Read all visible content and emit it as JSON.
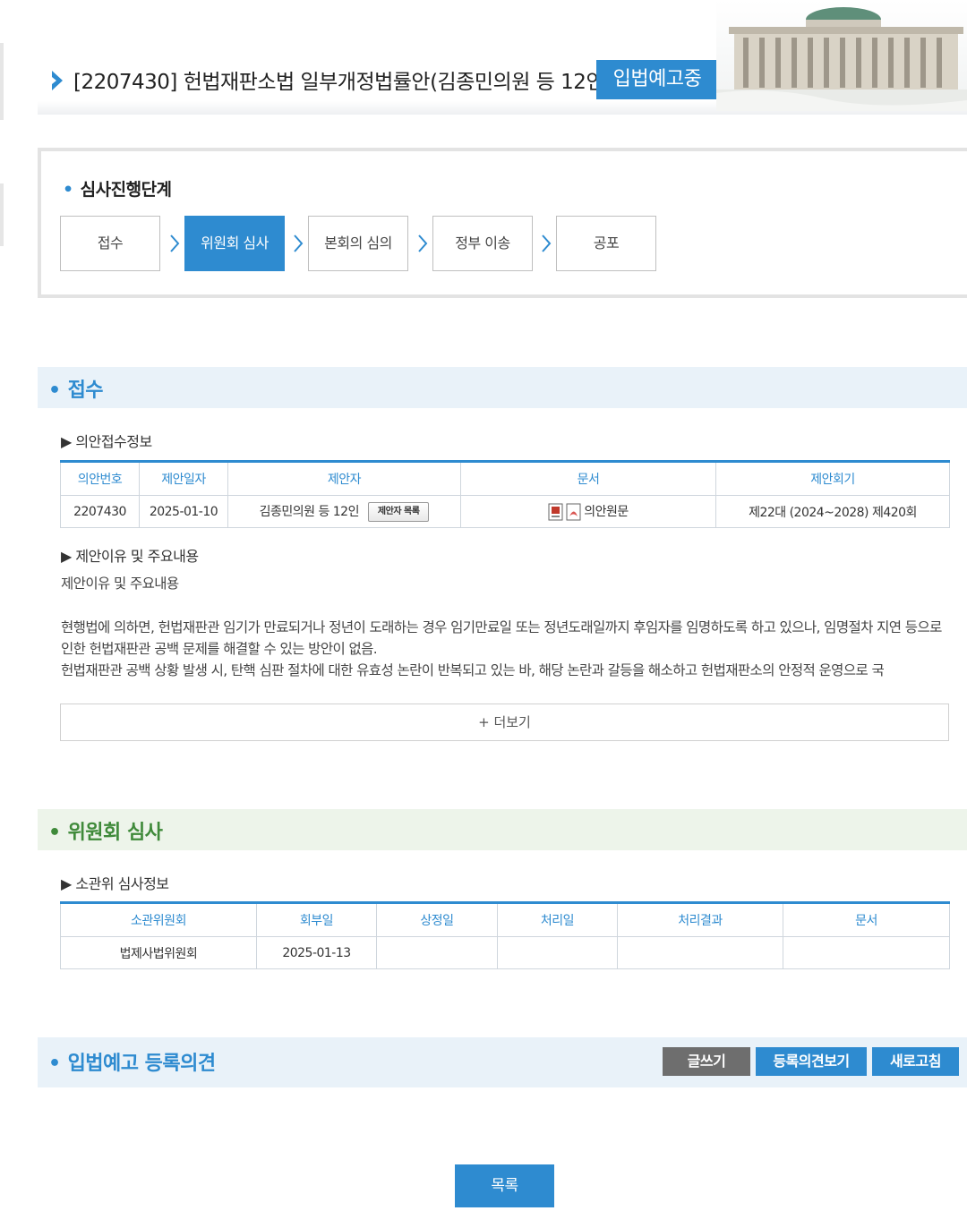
{
  "header": {
    "bill_title": "[2207430] 헌법재판소법 일부개정법률안(김종민의원 등 12인)",
    "status_badge": "입법예고중"
  },
  "progress": {
    "title": "심사진행단계",
    "steps": [
      {
        "label": "접수",
        "active": false
      },
      {
        "label": "위원회 심사",
        "active": true
      },
      {
        "label": "본회의 심의",
        "active": false
      },
      {
        "label": "정부 이송",
        "active": false
      },
      {
        "label": "공포",
        "active": false
      }
    ]
  },
  "receipt": {
    "section_title": "접수",
    "info_subtitle": "▶ 의안접수정보",
    "table": {
      "headers": [
        "의안번호",
        "제안일자",
        "제안자",
        "문서",
        "제안회기"
      ],
      "row": {
        "bill_no": "2207430",
        "date": "2025-01-10",
        "proposer": "김종민의원 등 12인",
        "proposer_list_btn": "제안자 목록",
        "document": "의안원문",
        "session": "제22대 (2024~2028) 제420회"
      }
    },
    "reason_subtitle": "▶ 제안이유 및 주요내용",
    "reason_heading": "제안이유 및 주요내용",
    "paragraph1": "현행법에 의하면, 헌법재판관 임기가 만료되거나 정년이 도래하는 경우 임기만료일 또는 정년도래일까지 후임자를 임명하도록 하고 있으나, 임명절차 지연 등으로 인한 헌법재판관 공백 문제를 해결할 수 있는 방안이 없음.",
    "paragraph2": "헌법재판관 공백 상황 발생 시, 탄핵 심판 절차에 대한 유효성 논란이 반복되고 있는 바, 해당 논란과 갈등을 해소하고 헌법재판소의 안정적 운영으로 국",
    "more_btn": "+ 더보기"
  },
  "committee": {
    "section_title": "위원회 심사",
    "subtitle": "▶ 소관위 심사정보",
    "table": {
      "headers": [
        "소관위원회",
        "회부일",
        "상정일",
        "처리일",
        "처리결과",
        "문서"
      ],
      "row": [
        "법제사법위원회",
        "2025-01-13",
        "",
        "",
        "",
        ""
      ]
    }
  },
  "opinions": {
    "section_title": "입법예고 등록의견",
    "write_btn": "글쓰기",
    "view_btn": "등록의견보기",
    "refresh_btn": "새로고침"
  },
  "footer": {
    "list_btn": "목록"
  },
  "colors": {
    "accent": "#2e8bd0",
    "receipt_header_bg": "#e9f2f9",
    "committee_header_bg": "#edf4ea",
    "opinion_header_bg": "#e9f2f9",
    "write_btn_bg": "#6e6e6e",
    "committee_title": "#3f8a3a"
  }
}
